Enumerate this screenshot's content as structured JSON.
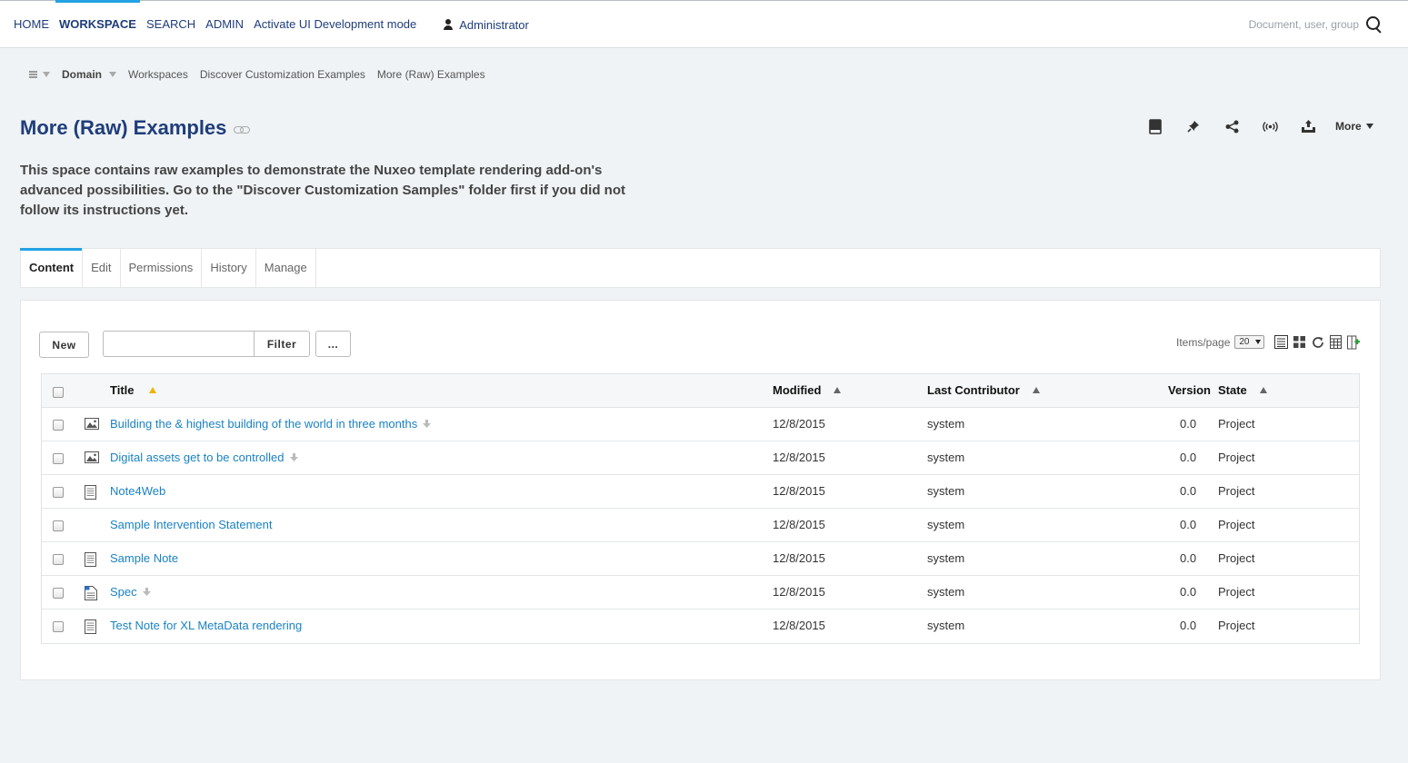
{
  "topnav": {
    "home": "HOME",
    "workspace": "WORKSPACE",
    "search": "SEARCH",
    "admin": "ADMIN",
    "dev_mode": "Activate UI Development mode",
    "user": "Administrator",
    "search_placeholder": "Document, user, group"
  },
  "breadcrumb": {
    "domain": "Domain",
    "items": [
      "Workspaces",
      "Discover Customization Examples",
      "More (Raw) Examples"
    ]
  },
  "page": {
    "title": "More (Raw) Examples",
    "more_label": "More",
    "description": "This space contains raw examples to demonstrate the Nuxeo template rendering add-on's advanced possibilities. Go to the \"Discover Customization Samples\" folder first if you did not follow its instructions yet."
  },
  "tabs": [
    "Content",
    "Edit",
    "Permissions",
    "History",
    "Manage"
  ],
  "toolbar": {
    "new_label": "New",
    "filter_label": "Filter",
    "more_label": "...",
    "items_per_page_label": "Items/page",
    "items_per_page_value": "20"
  },
  "table": {
    "headers": {
      "title": "Title",
      "modified": "Modified",
      "contributor": "Last Contributor",
      "version": "Version",
      "state": "State"
    },
    "rows": [
      {
        "title": "Building the & highest building of the world in three months",
        "icon": "picture-icon",
        "download": true,
        "modified": "12/8/2015",
        "contributor": "system",
        "version": "0.0",
        "state": "Project"
      },
      {
        "title": "Digital assets get to be controlled",
        "icon": "picture-icon",
        "download": true,
        "modified": "12/8/2015",
        "contributor": "system",
        "version": "0.0",
        "state": "Project"
      },
      {
        "title": "Note4Web",
        "icon": "note-icon",
        "download": false,
        "modified": "12/8/2015",
        "contributor": "system",
        "version": "0.0",
        "state": "Project"
      },
      {
        "title": "Sample Intervention Statement",
        "icon": "",
        "download": false,
        "modified": "12/8/2015",
        "contributor": "system",
        "version": "0.0",
        "state": "Project"
      },
      {
        "title": "Sample Note",
        "icon": "note-icon",
        "download": false,
        "modified": "12/8/2015",
        "contributor": "system",
        "version": "0.0",
        "state": "Project"
      },
      {
        "title": "Spec",
        "icon": "file-icon",
        "download": true,
        "modified": "12/8/2015",
        "contributor": "system",
        "version": "0.0",
        "state": "Project"
      },
      {
        "title": "Test Note for XL MetaData rendering",
        "icon": "note-icon",
        "download": false,
        "modified": "12/8/2015",
        "contributor": "system",
        "version": "0.0",
        "state": "Project"
      }
    ]
  }
}
